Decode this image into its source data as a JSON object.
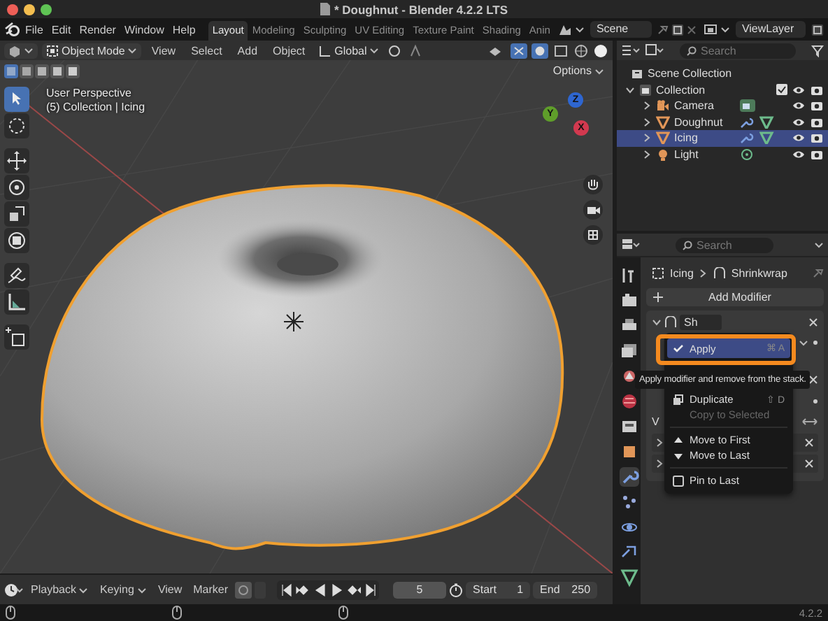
{
  "window": {
    "title": "* Doughnut - Blender 4.2.2 LTS"
  },
  "menu_bar": [
    "File",
    "Edit",
    "Render",
    "Window",
    "Help"
  ],
  "workspaces": [
    {
      "label": "Layout",
      "selected": true
    },
    {
      "label": "Modeling",
      "selected": false
    },
    {
      "label": "Sculpting",
      "selected": false
    },
    {
      "label": "UV Editing",
      "selected": false
    },
    {
      "label": "Texture Paint",
      "selected": false
    },
    {
      "label": "Shading",
      "selected": false
    },
    {
      "label": "Anin",
      "selected": false
    }
  ],
  "scene": "Scene",
  "view_layer": "ViewLayer",
  "viewport": {
    "mode": "Object Mode",
    "menus": [
      "View",
      "Select",
      "Add",
      "Object"
    ],
    "orientation": "Global",
    "options": "Options",
    "view_name": "User Perspective",
    "context": "(5) Collection | Icing",
    "gizmo": [
      {
        "label": "Z",
        "color": "#2e66d1"
      },
      {
        "label": "Y",
        "color": "#5f9e2a"
      },
      {
        "label": "X",
        "color": "#d2394f"
      }
    ]
  },
  "outliner": {
    "search": {
      "placeholder": "Search"
    },
    "root": "Scene Collection",
    "collection": {
      "label": "Collection",
      "expanded": true,
      "children": [
        {
          "label": "Camera",
          "kind": "camera",
          "selected": false
        },
        {
          "label": "Doughnut",
          "kind": "mesh",
          "selected": false
        },
        {
          "label": "Icing",
          "kind": "mesh",
          "selected": true
        },
        {
          "label": "Light",
          "kind": "light",
          "selected": false
        }
      ]
    }
  },
  "properties": {
    "search": {
      "placeholder": "Search"
    },
    "breadcrumb": [
      "Icing",
      "Shrinkwrap"
    ],
    "add_modifier": "Add Modifier",
    "modifier_name": "Sh",
    "cut_label": "V",
    "tabs": [
      {
        "selected": false
      },
      {
        "selected": false
      },
      {
        "selected": false
      },
      {
        "selected": false
      },
      {
        "selected": false
      },
      {
        "selected": false
      },
      {
        "selected": false
      },
      {
        "selected": false
      },
      {
        "selected": true
      },
      {
        "selected": false
      },
      {
        "selected": false
      },
      {
        "selected": false
      },
      {
        "selected": false
      }
    ]
  },
  "context_menu": {
    "groups": [
      [
        {
          "label": "Apply",
          "shortcut": "⌘ A",
          "kind": "check",
          "highlighted": true,
          "disabled": false
        }
      ],
      [
        {
          "label": "Duplicate",
          "shortcut": "⇧ D",
          "kind": "copy",
          "highlighted": false,
          "disabled": false
        },
        {
          "label": "Copy to Selected",
          "kind": "none",
          "highlighted": false,
          "disabled": true
        }
      ],
      [
        {
          "label": "Move to First",
          "kind": "up",
          "highlighted": false,
          "disabled": false
        },
        {
          "label": "Move to Last",
          "kind": "down",
          "highlighted": false,
          "disabled": false
        }
      ],
      [
        {
          "label": "Pin to Last",
          "kind": "box",
          "checked": false,
          "highlighted": false,
          "disabled": false
        }
      ]
    ]
  },
  "tooltip": "Apply modifier and remove from the stack.",
  "timeline": {
    "menus": [
      "Playback",
      "Keying",
      "View",
      "Marker"
    ],
    "frame": "5",
    "start_label": "Start",
    "start": "1",
    "end_label": "End",
    "end": "250"
  },
  "status_bar": {
    "version": "4.2.2"
  }
}
